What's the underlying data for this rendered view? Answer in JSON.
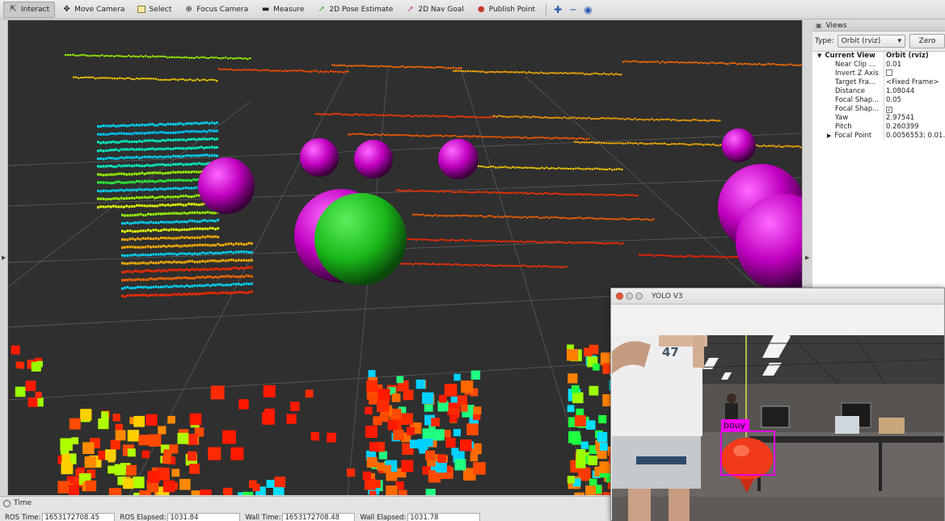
{
  "toolbar": {
    "tools": [
      {
        "label": "Interact",
        "icon": "interact-icon",
        "active": true
      },
      {
        "label": "Move Camera",
        "icon": "move-camera-icon",
        "active": false
      },
      {
        "label": "Select",
        "icon": "select-icon",
        "active": false
      },
      {
        "label": "Focus Camera",
        "icon": "focus-camera-icon",
        "active": false
      },
      {
        "label": "Measure",
        "icon": "measure-icon",
        "active": false
      },
      {
        "label": "2D Pose Estimate",
        "icon": "pose-estimate-icon",
        "active": false
      },
      {
        "label": "2D Nav Goal",
        "icon": "nav-goal-icon",
        "active": false
      },
      {
        "label": "Publish Point",
        "icon": "publish-point-icon",
        "active": false
      }
    ],
    "extra_icons": [
      "add-tool-icon",
      "remove-tool-icon",
      "tool-options-icon"
    ],
    "colors": {
      "pose": "#3aa83a",
      "goal": "#c93aa0",
      "point": "#c33a2a"
    }
  },
  "views": {
    "title": "Views",
    "type_label": "Type:",
    "type_value": "Orbit (rviz)",
    "zero_label": "Zero",
    "current_view_key": "Current View",
    "current_view_value": "Orbit (rviz)",
    "properties": [
      {
        "key": "Near Clip ...",
        "value": "0.01",
        "kind": "text"
      },
      {
        "key": "Invert Z Axis",
        "value": "",
        "kind": "checkbox",
        "checked": false
      },
      {
        "key": "Target Fra...",
        "value": "<Fixed Frame>",
        "kind": "text"
      },
      {
        "key": "Distance",
        "value": "1.08044",
        "kind": "text"
      },
      {
        "key": "Focal Shap...",
        "value": "0.05",
        "kind": "text"
      },
      {
        "key": "Focal Shap...",
        "value": "",
        "kind": "checkbox",
        "checked": true
      },
      {
        "key": "Yaw",
        "value": "2.97541",
        "kind": "text"
      },
      {
        "key": "Pitch",
        "value": "0.260399",
        "kind": "text"
      },
      {
        "key": "Focal Point",
        "value": "0.0056553; 0.01...",
        "kind": "text",
        "expandable": true
      }
    ]
  },
  "time": {
    "title": "Time",
    "ros_time_label": "ROS Time:",
    "ros_time": "1653172708.45",
    "ros_elapsed_label": "ROS Elapsed:",
    "ros_elapsed": "1031.84",
    "wall_time_label": "Wall Time:",
    "wall_time": "1653172708.48",
    "wall_elapsed_label": "Wall Elapsed:",
    "wall_elapsed": "1031.78"
  },
  "yolo": {
    "title": "YOLO V3",
    "detection_label": "bouy",
    "shirt_text": "47",
    "detection_color": "#ff00ff"
  },
  "scene": {
    "background": "#2f2f2f",
    "marker_color_purple": "#c000c0",
    "marker_color_green": "#1ec81e"
  }
}
